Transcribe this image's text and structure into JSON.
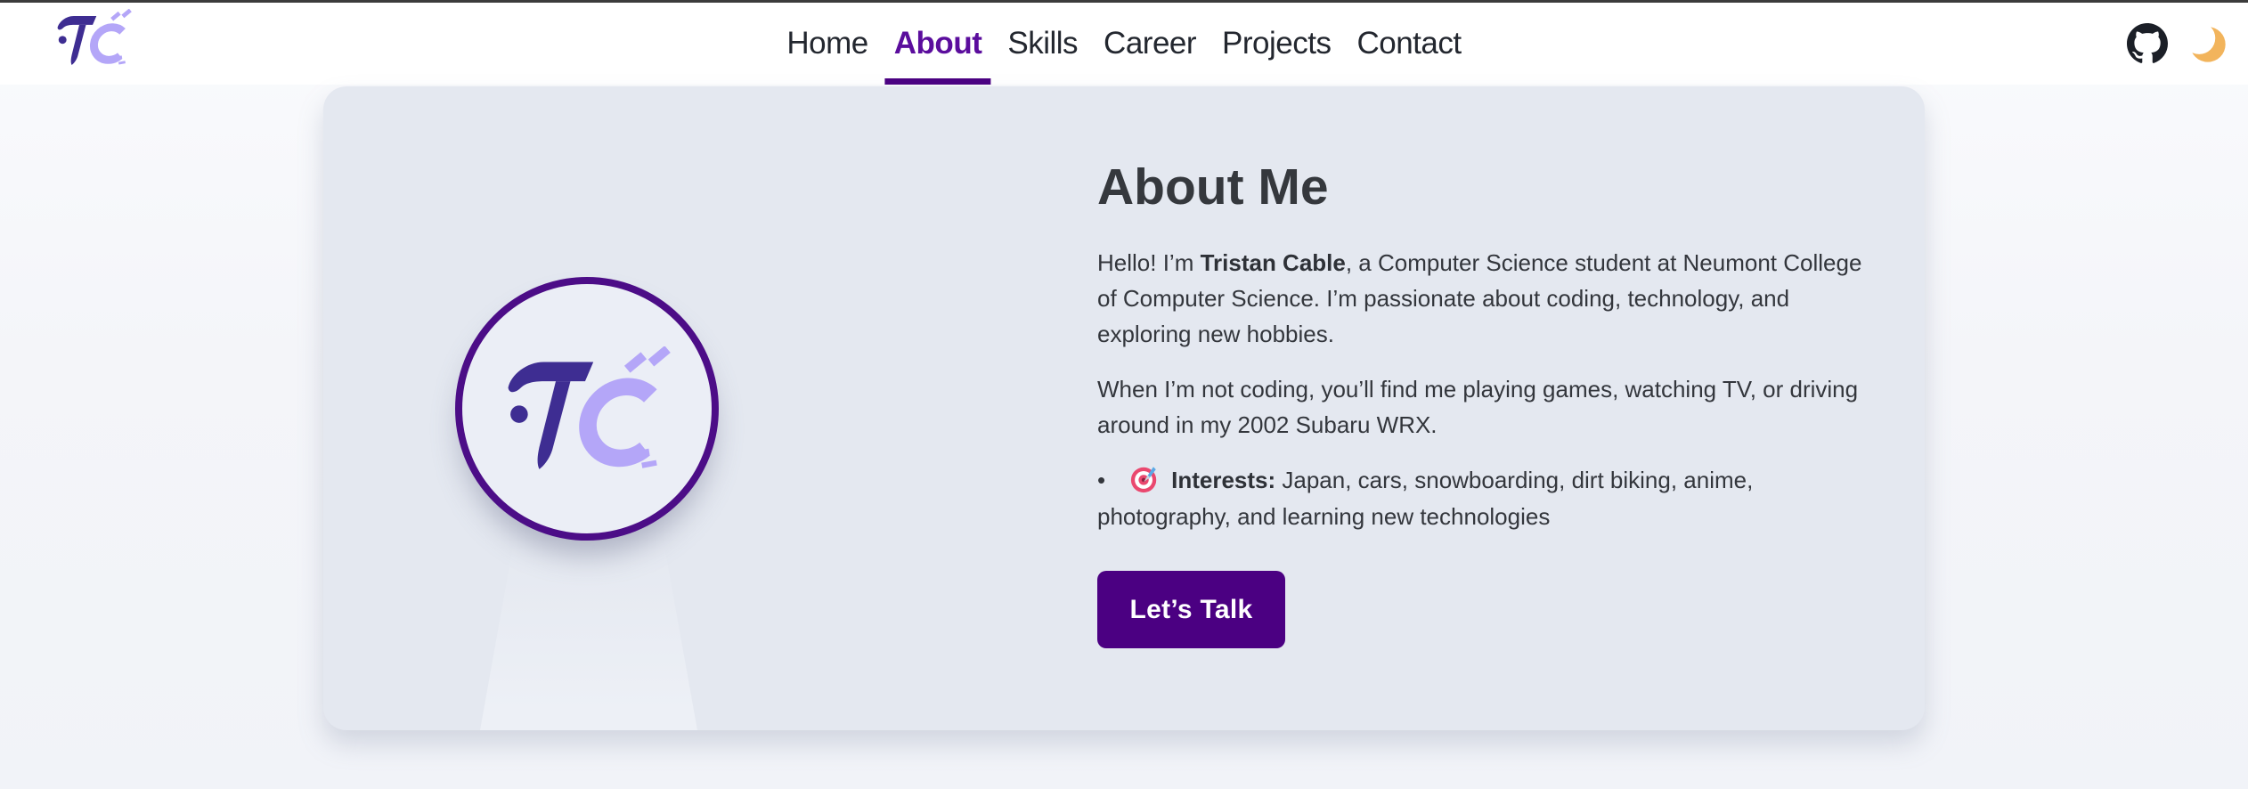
{
  "nav": {
    "logo_alt": "TC",
    "links": [
      {
        "label": "Home",
        "active": false
      },
      {
        "label": "About",
        "active": true
      },
      {
        "label": "Skills",
        "active": false
      },
      {
        "label": "Career",
        "active": false
      },
      {
        "label": "Projects",
        "active": false
      },
      {
        "label": "Contact",
        "active": false
      }
    ],
    "icons": [
      {
        "name": "github-icon"
      },
      {
        "name": "moon-theme-toggle-icon"
      }
    ]
  },
  "about": {
    "heading": "About Me",
    "intro": {
      "pre": "Hello! I’m ",
      "name": "Tristan Cable",
      "post": ", a Computer Science student at Neumont College of Computer Science. I’m passionate about coding, technology, and exploring new hobbies."
    },
    "hobbies": "When I’m not coding, you’ll find me playing games, watching TV, or driving around in my 2002 Subaru WRX.",
    "interests": {
      "bullet": "•",
      "icon": "dartboard-emoji",
      "label": "Interests:",
      "text": " Japan, cars, snowboarding, dirt biking, anime, photography, and learning new technologies"
    },
    "cta_label": "Let’s Talk"
  },
  "colors": {
    "accent_purple": "#4b0082",
    "nav_active_purple": "#5b0d9d",
    "logo_dark_purple": "#3e2d92",
    "logo_light_lavender": "#b4a6f8",
    "card_background": "#e4e8f0",
    "moon_gold": "#f2b45c",
    "github_dark": "#1b1f27"
  }
}
